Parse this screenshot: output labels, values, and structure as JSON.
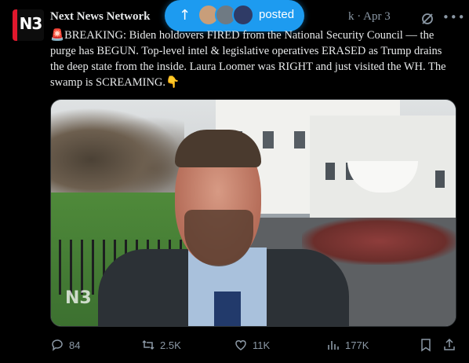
{
  "tweet": {
    "author_name": "Next News Network",
    "handle_date": "k · Apr 3",
    "avatar_text": "N3",
    "text_siren": "🚨",
    "text": "BREAKING: Biden holdovers FIRED from the National Security Council — the purge has BEGUN. Top-level intel & legislative operatives ERASED as Trump drains the deep state from the inside. Laura Loomer was RIGHT and just visited the WH. The swamp is SCREAMING.👇",
    "media_watermark": "N3"
  },
  "posted_pill": {
    "label": "posted",
    "arrow": "↑"
  },
  "actions": {
    "replies": "84",
    "reposts": "2.5K",
    "likes": "11K",
    "views": "177K"
  },
  "colors": {
    "background": "#000000",
    "text": "#e7e9ea",
    "muted": "#8b98a5",
    "accent": "#1d9bf0",
    "brand_red": "#e0182d"
  },
  "icons": [
    "grok-icon",
    "more-icon",
    "reply-icon",
    "repost-icon",
    "like-icon",
    "views-icon",
    "bookmark-icon",
    "share-icon"
  ]
}
